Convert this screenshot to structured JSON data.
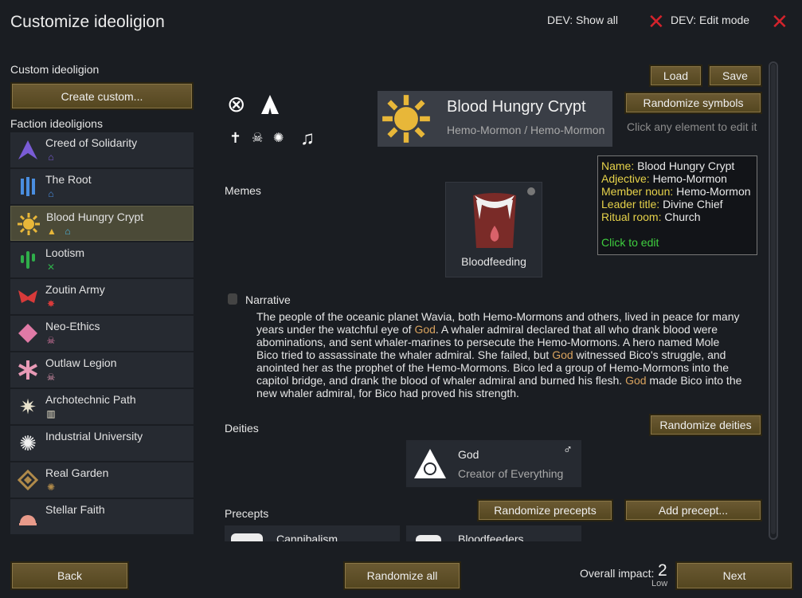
{
  "header": {
    "title": "Customize ideoligion",
    "dev_show_all": "DEV: Show all",
    "dev_edit_mode": "DEV: Edit mode"
  },
  "sidebar": {
    "custom_label": "Custom ideoligion",
    "create_button": "Create custom...",
    "faction_label": "Faction ideoligions",
    "items": [
      {
        "name": "Creed of Solidarity",
        "color": "#7a5cd6"
      },
      {
        "name": "The Root",
        "color": "#4a8ee0"
      },
      {
        "name": "Blood Hungry Crypt",
        "color": "#e8b739"
      },
      {
        "name": "Lootism",
        "color": "#2fae4a"
      },
      {
        "name": "Zoutin Army",
        "color": "#d83a3a"
      },
      {
        "name": "Neo-Ethics",
        "color": "#e07aa6"
      },
      {
        "name": "Outlaw Legion",
        "color": "#e89ab6"
      },
      {
        "name": "Archotechnic Path",
        "color": "#e8e2cc"
      },
      {
        "name": "Industrial University",
        "color": "#f0f0f0"
      },
      {
        "name": "Real Garden",
        "color": "#b08a4a"
      },
      {
        "name": "Stellar Faith",
        "color": "#e89a8a"
      }
    ]
  },
  "toolbar": {
    "load": "Load",
    "save": "Save",
    "randomize_symbols": "Randomize symbols",
    "hint": "Click any element to edit it"
  },
  "ideo": {
    "name": "Blood Hungry Crypt",
    "adjectives": "Hemo-Mormon / Hemo-Mormon",
    "accent_color": "#e8b739"
  },
  "info": {
    "name_key": "Name:",
    "name_val": "Blood Hungry Crypt",
    "adj_key": "Adjective:",
    "adj_val": "Hemo-Mormon",
    "member_key": "Member noun:",
    "member_val": "Hemo-Mormon",
    "leader_key": "Leader title:",
    "leader_val": "Divine Chief",
    "ritual_key": "Ritual room:",
    "ritual_val": "Church",
    "click_to_edit": "Click to edit"
  },
  "memes": {
    "label": "Memes",
    "items": [
      {
        "name": "Bloodfeeding"
      }
    ]
  },
  "narrative": {
    "label": "Narrative",
    "p1": "The people of the oceanic planet Wavia, both Hemo-Mormons and others, lived in peace for many years under the watchful eye of ",
    "god1": "God",
    "p2": ". A whaler admiral declared that all who drank blood were abominations, and sent whaler-marines to persecute the Hemo-Mormons. A hero named Mole Bico tried to assassinate the whaler admiral. She failed, but ",
    "god2": "God",
    "p3": " witnessed Bico's struggle, and anointed her as the prophet of the Hemo-Mormons. Bico led a group of Hemo-Mormons into the capitol bridge, and drank the blood of whaler admiral and burned his flesh. ",
    "god3": "God",
    "p4": " made Bico into the new whaler admiral, for Bico had proved his strength."
  },
  "deities": {
    "label": "Deities",
    "randomize": "Randomize deities",
    "items": [
      {
        "name": "God",
        "title": "Creator of Everything",
        "gender_icon": "male-icon"
      }
    ]
  },
  "precepts": {
    "label": "Precepts",
    "randomize": "Randomize precepts",
    "add": "Add precept...",
    "items": [
      {
        "name": "Cannibalism"
      },
      {
        "name": "Bloodfeeders"
      }
    ]
  },
  "footer": {
    "back": "Back",
    "randomize_all": "Randomize all",
    "impact_label": "Overall impact:",
    "impact_value": "2",
    "impact_level": "Low",
    "next": "Next"
  }
}
